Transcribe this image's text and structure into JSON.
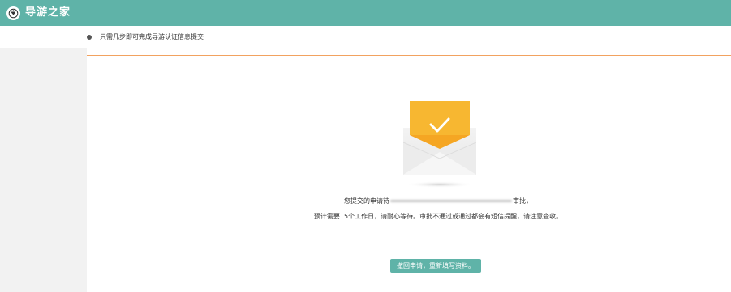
{
  "header": {
    "logo_icon": "guide-badge-icon",
    "title": "导游之家",
    "background": "#5fb3a8"
  },
  "notice": {
    "bullet": "bullet-dot",
    "text": "只需几步即可完成导游认证信息提交"
  },
  "status": {
    "icon": "envelope-check-icon",
    "line1_prefix": "您提交的申请待",
    "line1_suffix": "审批，",
    "line2": "预计需要15个工作日，请耐心等待。审批不通过或通过都会有短信提醒，请注意查收。"
  },
  "actions": {
    "withdraw_label": "撤回申请，重新填写资料。"
  },
  "colors": {
    "accent": "#5fb3a8",
    "divider": "#f2a260",
    "envelope_card": "#f7b731"
  }
}
